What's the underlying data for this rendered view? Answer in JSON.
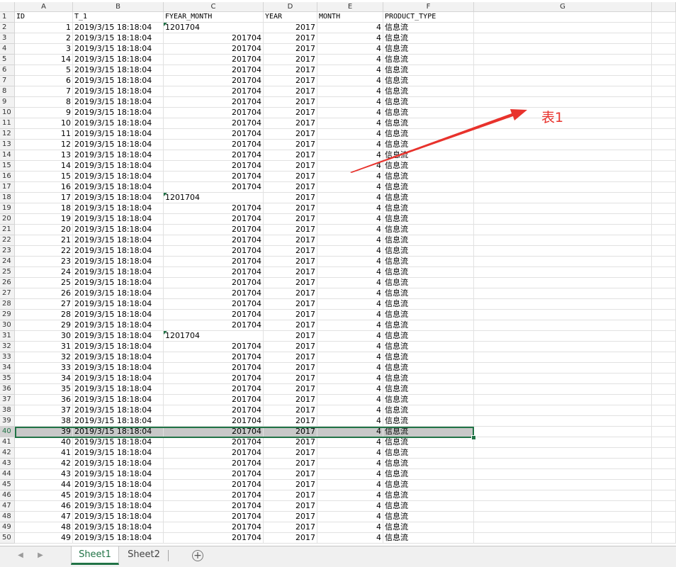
{
  "columns": {
    "A": "A",
    "B": "B",
    "C": "C",
    "D": "D",
    "E": "E",
    "F": "F",
    "G": "G"
  },
  "header_row": {
    "row_label": "1",
    "A": "ID",
    "B": "T_1",
    "C": "FYEAR_MONTH",
    "D": "YEAR",
    "E": "MONTH",
    "F": "PRODUCT_TYPE"
  },
  "rows": [
    {
      "r": "2",
      "id": "1",
      "t": "2019/3/15  18:18:04",
      "fym": "1201704",
      "fym_text": true,
      "year": "2017",
      "month": "4",
      "type": "信息流"
    },
    {
      "r": "3",
      "id": "2",
      "t": "2019/3/15  18:18:04",
      "fym": "201704",
      "fym_text": false,
      "year": "2017",
      "month": "4",
      "type": "信息流"
    },
    {
      "r": "4",
      "id": "3",
      "t": "2019/3/15  18:18:04",
      "fym": "201704",
      "fym_text": false,
      "year": "2017",
      "month": "4",
      "type": "信息流"
    },
    {
      "r": "5",
      "id": "14",
      "t": "2019/3/15  18:18:04",
      "fym": "201704",
      "fym_text": false,
      "year": "2017",
      "month": "4",
      "type": "信息流"
    },
    {
      "r": "6",
      "id": "5",
      "t": "2019/3/15  18:18:04",
      "fym": "201704",
      "fym_text": false,
      "year": "2017",
      "month": "4",
      "type": "信息流"
    },
    {
      "r": "7",
      "id": "6",
      "t": "2019/3/15  18:18:04",
      "fym": "201704",
      "fym_text": false,
      "year": "2017",
      "month": "4",
      "type": "信息流"
    },
    {
      "r": "8",
      "id": "7",
      "t": "2019/3/15  18:18:04",
      "fym": "201704",
      "fym_text": false,
      "year": "2017",
      "month": "4",
      "type": "信息流"
    },
    {
      "r": "9",
      "id": "8",
      "t": "2019/3/15  18:18:04",
      "fym": "201704",
      "fym_text": false,
      "year": "2017",
      "month": "4",
      "type": "信息流"
    },
    {
      "r": "10",
      "id": "9",
      "t": "2019/3/15  18:18:04",
      "fym": "201704",
      "fym_text": false,
      "year": "2017",
      "month": "4",
      "type": "信息流"
    },
    {
      "r": "11",
      "id": "10",
      "t": "2019/3/15  18:18:04",
      "fym": "201704",
      "fym_text": false,
      "year": "2017",
      "month": "4",
      "type": "信息流"
    },
    {
      "r": "12",
      "id": "11",
      "t": "2019/3/15  18:18:04",
      "fym": "201704",
      "fym_text": false,
      "year": "2017",
      "month": "4",
      "type": "信息流"
    },
    {
      "r": "13",
      "id": "12",
      "t": "2019/3/15  18:18:04",
      "fym": "201704",
      "fym_text": false,
      "year": "2017",
      "month": "4",
      "type": "信息流"
    },
    {
      "r": "14",
      "id": "13",
      "t": "2019/3/15  18:18:04",
      "fym": "201704",
      "fym_text": false,
      "year": "2017",
      "month": "4",
      "type": "信息流"
    },
    {
      "r": "15",
      "id": "14",
      "t": "2019/3/15  18:18:04",
      "fym": "201704",
      "fym_text": false,
      "year": "2017",
      "month": "4",
      "type": "信息流"
    },
    {
      "r": "16",
      "id": "15",
      "t": "2019/3/15  18:18:04",
      "fym": "201704",
      "fym_text": false,
      "year": "2017",
      "month": "4",
      "type": "信息流"
    },
    {
      "r": "17",
      "id": "16",
      "t": "2019/3/15  18:18:04",
      "fym": "201704",
      "fym_text": false,
      "year": "2017",
      "month": "4",
      "type": "信息流"
    },
    {
      "r": "18",
      "id": "17",
      "t": "2019/3/15  18:18:04",
      "fym": "1201704",
      "fym_text": true,
      "year": "2017",
      "month": "4",
      "type": "信息流"
    },
    {
      "r": "19",
      "id": "18",
      "t": "2019/3/15  18:18:04",
      "fym": "201704",
      "fym_text": false,
      "year": "2017",
      "month": "4",
      "type": "信息流"
    },
    {
      "r": "20",
      "id": "19",
      "t": "2019/3/15  18:18:04",
      "fym": "201704",
      "fym_text": false,
      "year": "2017",
      "month": "4",
      "type": "信息流"
    },
    {
      "r": "21",
      "id": "20",
      "t": "2019/3/15  18:18:04",
      "fym": "201704",
      "fym_text": false,
      "year": "2017",
      "month": "4",
      "type": "信息流"
    },
    {
      "r": "22",
      "id": "21",
      "t": "2019/3/15  18:18:04",
      "fym": "201704",
      "fym_text": false,
      "year": "2017",
      "month": "4",
      "type": "信息流"
    },
    {
      "r": "23",
      "id": "22",
      "t": "2019/3/15  18:18:04",
      "fym": "201704",
      "fym_text": false,
      "year": "2017",
      "month": "4",
      "type": "信息流"
    },
    {
      "r": "24",
      "id": "23",
      "t": "2019/3/15  18:18:04",
      "fym": "201704",
      "fym_text": false,
      "year": "2017",
      "month": "4",
      "type": "信息流"
    },
    {
      "r": "25",
      "id": "24",
      "t": "2019/3/15  18:18:04",
      "fym": "201704",
      "fym_text": false,
      "year": "2017",
      "month": "4",
      "type": "信息流"
    },
    {
      "r": "26",
      "id": "25",
      "t": "2019/3/15  18:18:04",
      "fym": "201704",
      "fym_text": false,
      "year": "2017",
      "month": "4",
      "type": "信息流"
    },
    {
      "r": "27",
      "id": "26",
      "t": "2019/3/15  18:18:04",
      "fym": "201704",
      "fym_text": false,
      "year": "2017",
      "month": "4",
      "type": "信息流"
    },
    {
      "r": "28",
      "id": "27",
      "t": "2019/3/15  18:18:04",
      "fym": "201704",
      "fym_text": false,
      "year": "2017",
      "month": "4",
      "type": "信息流"
    },
    {
      "r": "29",
      "id": "28",
      "t": "2019/3/15  18:18:04",
      "fym": "201704",
      "fym_text": false,
      "year": "2017",
      "month": "4",
      "type": "信息流"
    },
    {
      "r": "30",
      "id": "29",
      "t": "2019/3/15  18:18:04",
      "fym": "201704",
      "fym_text": false,
      "year": "2017",
      "month": "4",
      "type": "信息流"
    },
    {
      "r": "31",
      "id": "30",
      "t": "2019/3/15  18:18:04",
      "fym": "1201704",
      "fym_text": true,
      "year": "2017",
      "month": "4",
      "type": "信息流"
    },
    {
      "r": "32",
      "id": "31",
      "t": "2019/3/15  18:18:04",
      "fym": "201704",
      "fym_text": false,
      "year": "2017",
      "month": "4",
      "type": "信息流"
    },
    {
      "r": "33",
      "id": "32",
      "t": "2019/3/15  18:18:04",
      "fym": "201704",
      "fym_text": false,
      "year": "2017",
      "month": "4",
      "type": "信息流"
    },
    {
      "r": "34",
      "id": "33",
      "t": "2019/3/15  18:18:04",
      "fym": "201704",
      "fym_text": false,
      "year": "2017",
      "month": "4",
      "type": "信息流"
    },
    {
      "r": "35",
      "id": "34",
      "t": "2019/3/15  18:18:04",
      "fym": "201704",
      "fym_text": false,
      "year": "2017",
      "month": "4",
      "type": "信息流"
    },
    {
      "r": "36",
      "id": "35",
      "t": "2019/3/15  18:18:04",
      "fym": "201704",
      "fym_text": false,
      "year": "2017",
      "month": "4",
      "type": "信息流"
    },
    {
      "r": "37",
      "id": "36",
      "t": "2019/3/15  18:18:04",
      "fym": "201704",
      "fym_text": false,
      "year": "2017",
      "month": "4",
      "type": "信息流"
    },
    {
      "r": "38",
      "id": "37",
      "t": "2019/3/15  18:18:04",
      "fym": "201704",
      "fym_text": false,
      "year": "2017",
      "month": "4",
      "type": "信息流"
    },
    {
      "r": "39",
      "id": "38",
      "t": "2019/3/15  18:18:04",
      "fym": "201704",
      "fym_text": false,
      "year": "2017",
      "month": "4",
      "type": "信息流"
    },
    {
      "r": "40",
      "id": "39",
      "t": "2019/3/15  18:18:04",
      "fym": "201704",
      "fym_text": false,
      "year": "2017",
      "month": "4",
      "type": "信息流",
      "selected": true
    },
    {
      "r": "41",
      "id": "40",
      "t": "2019/3/15  18:18:04",
      "fym": "201704",
      "fym_text": false,
      "year": "2017",
      "month": "4",
      "type": "信息流"
    },
    {
      "r": "42",
      "id": "41",
      "t": "2019/3/15  18:18:04",
      "fym": "201704",
      "fym_text": false,
      "year": "2017",
      "month": "4",
      "type": "信息流"
    },
    {
      "r": "43",
      "id": "42",
      "t": "2019/3/15  18:18:04",
      "fym": "201704",
      "fym_text": false,
      "year": "2017",
      "month": "4",
      "type": "信息流"
    },
    {
      "r": "44",
      "id": "43",
      "t": "2019/3/15  18:18:04",
      "fym": "201704",
      "fym_text": false,
      "year": "2017",
      "month": "4",
      "type": "信息流"
    },
    {
      "r": "45",
      "id": "44",
      "t": "2019/3/15  18:18:04",
      "fym": "201704",
      "fym_text": false,
      "year": "2017",
      "month": "4",
      "type": "信息流"
    },
    {
      "r": "46",
      "id": "45",
      "t": "2019/3/15  18:18:04",
      "fym": "201704",
      "fym_text": false,
      "year": "2017",
      "month": "4",
      "type": "信息流"
    },
    {
      "r": "47",
      "id": "46",
      "t": "2019/3/15  18:18:04",
      "fym": "201704",
      "fym_text": false,
      "year": "2017",
      "month": "4",
      "type": "信息流"
    },
    {
      "r": "48",
      "id": "47",
      "t": "2019/3/15  18:18:04",
      "fym": "201704",
      "fym_text": false,
      "year": "2017",
      "month": "4",
      "type": "信息流"
    },
    {
      "r": "49",
      "id": "48",
      "t": "2019/3/15  18:18:04",
      "fym": "201704",
      "fym_text": false,
      "year": "2017",
      "month": "4",
      "type": "信息流"
    },
    {
      "r": "50",
      "id": "49",
      "t": "2019/3/15  18:18:04",
      "fym": "201704",
      "fym_text": false,
      "year": "2017",
      "month": "4",
      "type": "信息流"
    }
  ],
  "annotation": {
    "text": "表1",
    "color": "#e8322c"
  },
  "colors": {
    "accent": "#217346",
    "selection_fill": "#c8c8c8",
    "error_triangle": "#1e7145"
  },
  "sheet_tabs": {
    "nav_prev_icon": "triangle-left-icon",
    "nav_next_icon": "triangle-right-icon",
    "tabs": [
      {
        "label": "Sheet1",
        "active": true
      },
      {
        "label": "Sheet2",
        "active": false
      }
    ],
    "add_icon": "+"
  }
}
